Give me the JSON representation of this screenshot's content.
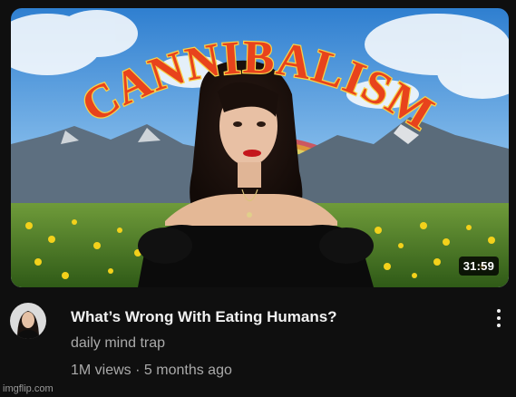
{
  "video": {
    "thumbnail_text": "CANNIBALISM",
    "duration": "31:59",
    "title": "What’s Wrong With Eating Humans?",
    "channel": "daily mind trap",
    "views": "1M views",
    "separator": "·",
    "age": "5 months ago"
  },
  "icons": {
    "menu": "more-vert-icon"
  },
  "watermark": "imgflip.com",
  "colors": {
    "background": "#0f0f0f",
    "title": "#f1f1f1",
    "secondary_text": "#aaaaaa",
    "thumbnail_text_fill": "#e8431c",
    "thumbnail_text_stroke": "#f7d24a"
  }
}
